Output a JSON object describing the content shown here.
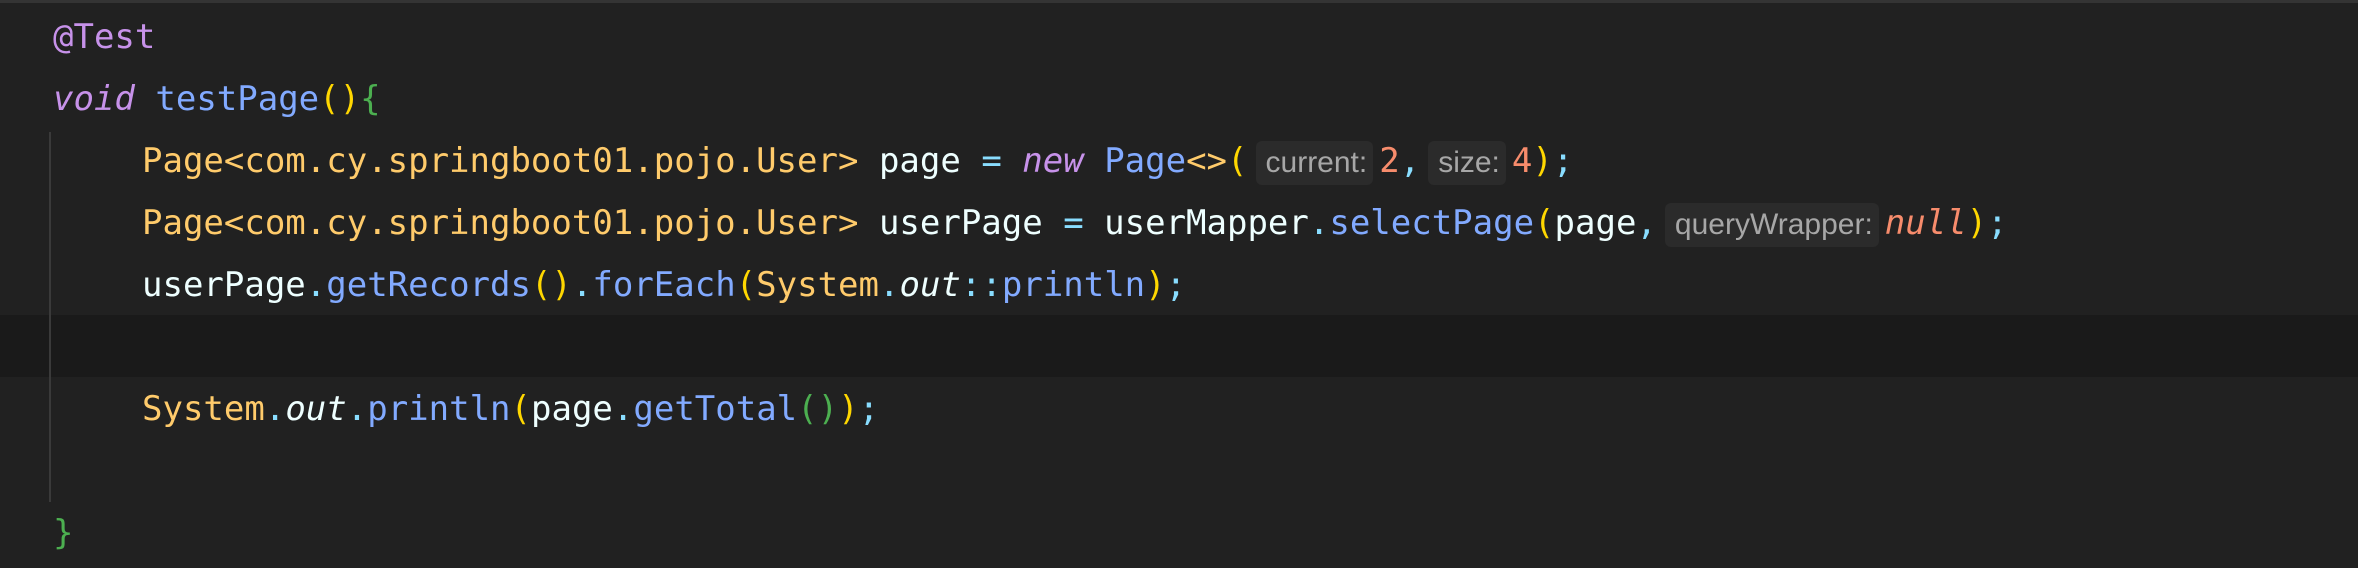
{
  "code": {
    "annotation": "@Test",
    "method_keyword": "void",
    "method_name": "testPage",
    "generic_type": "Page<com.cy.springboot01.pojo.User>",
    "page_var": "page",
    "new_keyword": "new",
    "page_class": "Page",
    "diamond": "<>",
    "hint_current": "current:",
    "current_value": "2",
    "hint_size": "size:",
    "size_value": "4",
    "user_page_var": "userPage",
    "mapper_var": "userMapper",
    "select_method": "selectPage",
    "hint_query_wrapper": "queryWrapper:",
    "null_keyword": "null",
    "get_records": "getRecords",
    "for_each": "forEach",
    "system_class": "System",
    "out_field": "out",
    "println_method": "println",
    "get_total": "getTotal",
    "close_brace": "}"
  },
  "colors": {
    "background": "#212121",
    "current_line": "#1a1a1a",
    "keyword": "#c792ea",
    "function": "#82aaff",
    "class": "#ffcb6b",
    "operator": "#89ddff",
    "number": "#f78c6c"
  }
}
